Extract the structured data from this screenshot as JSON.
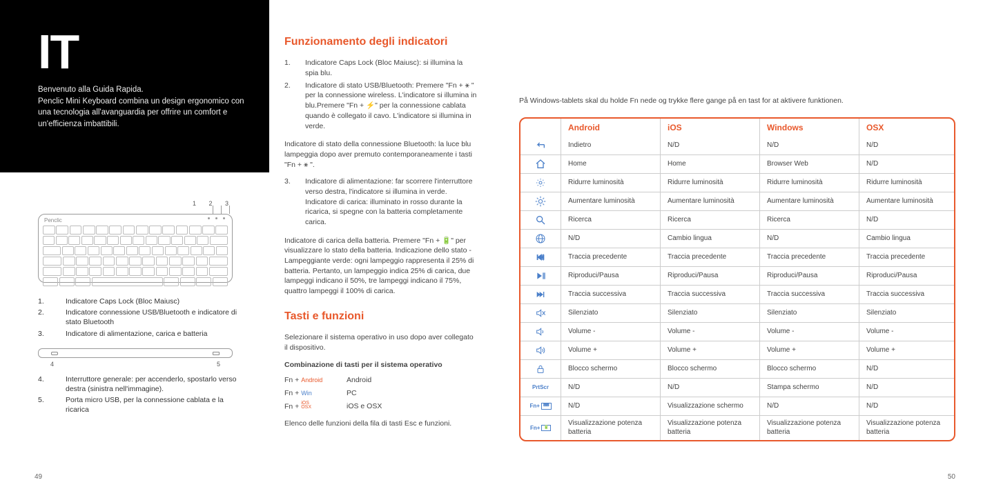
{
  "lang_code": "IT",
  "intro": "Benvenuto alla Guida Rapida.\nPenclic Mini Keyboard combina un design ergonomico con una tecnologia all'avanguardia per offrire un comfort e un'efficienza imbattibili.",
  "kb_top_labels": "1  2  3",
  "kb_brand": "Penclic",
  "indicator_list": [
    {
      "n": "1.",
      "t": "Indicatore Caps Lock (Bloc Maiusc)"
    },
    {
      "n": "2.",
      "t": "Indicatore connessione USB/Bluetooth e indicatore di stato Bluetooth"
    },
    {
      "n": "3.",
      "t": "Indicatore di alimentazione, carica e batteria"
    }
  ],
  "side_labels": {
    "l": "4",
    "r": "5"
  },
  "switch_list": [
    {
      "n": "4.",
      "t": "Interruttore generale: per accenderlo, spostarlo verso destra (sinistra nell'immagine)."
    },
    {
      "n": "5.",
      "t": "Porta micro USB, per la connessione cablata e la ricarica"
    }
  ],
  "section1_heading": "Funzionamento degli indicatori",
  "section1_items": [
    {
      "n": "1.",
      "t": "Indicatore Caps Lock (Bloc Maiusc): si illumina la spia blu."
    },
    {
      "n": "2.",
      "t": "Indicatore di stato USB/Bluetooth: Premere \"Fn + ⚹ \" per la connessione wireless. L'indicatore si illumina in blu.Premere \"Fn + ⚡\" per la connessione cablata quando è collegato il cavo. L'indicatore si illumina in verde."
    }
  ],
  "section1_para1": "Indicatore di stato della connessione Bluetooth: la luce blu lampeggia dopo aver premuto contemporaneamente i tasti \"Fn + ⚹ \".",
  "section1_item3": {
    "n": "3.",
    "t": "Indicatore di alimentazione: far scorrere l'interruttore verso destra, l'indicatore si illumina in verde. Indicatore di carica: illuminato in rosso durante la ricarica, si spegne con la batteria completamente carica."
  },
  "section1_para2": "Indicatore di carica della batteria. Premere \"Fn + 🔋\" per visualizzare lo stato della batteria. Indicazione dello stato - Lampeggiante verde: ogni lampeggio rappresenta il 25% di batteria. Pertanto, un lampeggio indica 25% di carica, due lampeggi indicano il 50%, tre lampeggi indicano il 75%, quattro lampeggi il 100% di carica.",
  "section2_heading": "Tasti e funzioni",
  "section2_para1": "Selezionare il sistema operativo in uso dopo aver collegato il dispositivo.",
  "section2_bold": "Combinazione di tasti per il sistema operativo",
  "combos": [
    {
      "key_pre": "Fn + ",
      "key_accent": "Android",
      "accent_class": "accent",
      "val": "Android"
    },
    {
      "key_pre": "Fn + ",
      "key_accent": "Win",
      "accent_class": "accent2",
      "val": "PC"
    },
    {
      "key_pre": "Fn + ",
      "key_accent": "iOS\nOSX",
      "accent_class": "accent3",
      "val": "iOS e OSX"
    }
  ],
  "section2_para2": "Elenco delle funzioni della fila di tasti Esc e funzioni.",
  "page_left": "49",
  "page_right": "50",
  "top_note": "På Windows-tablets skal du holde Fn nede og trykke flere gange på en tast for at aktivere funktionen.",
  "table": {
    "headers": [
      "",
      "Android",
      "iOS",
      "Windows",
      "OSX"
    ],
    "rows": [
      {
        "icon": "back",
        "cells": [
          "Indietro",
          "N/D",
          "N/D",
          "N/D"
        ]
      },
      {
        "icon": "home",
        "cells": [
          "Home",
          "Home",
          "Browser Web",
          "N/D"
        ]
      },
      {
        "icon": "bright-down",
        "cells": [
          "Ridurre luminosità",
          "Ridurre luminosità",
          "Ridurre luminosità",
          "Ridurre luminosità"
        ]
      },
      {
        "icon": "bright-up",
        "cells": [
          "Aumentare luminosità",
          "Aumentare luminosità",
          "Aumentare luminosità",
          "Aumentare luminosità"
        ]
      },
      {
        "icon": "search",
        "cells": [
          "Ricerca",
          "Ricerca",
          "Ricerca",
          "N/D"
        ]
      },
      {
        "icon": "globe",
        "cells": [
          "N/D",
          "Cambio lingua",
          "N/D",
          "Cambio lingua"
        ]
      },
      {
        "icon": "prev",
        "cells": [
          "Traccia precedente",
          "Traccia precedente",
          "Traccia precedente",
          "Traccia precedente"
        ]
      },
      {
        "icon": "play",
        "cells": [
          "Riproduci/Pausa",
          "Riproduci/Pausa",
          "Riproduci/Pausa",
          "Riproduci/Pausa"
        ]
      },
      {
        "icon": "next",
        "cells": [
          "Traccia successiva",
          "Traccia successiva",
          "Traccia successiva",
          "Traccia successiva"
        ]
      },
      {
        "icon": "mute",
        "cells": [
          "Silenziato",
          "Silenziato",
          "Silenziato",
          "Silenziato"
        ]
      },
      {
        "icon": "vol-down",
        "cells": [
          "Volume -",
          "Volume -",
          "Volume -",
          "Volume -"
        ]
      },
      {
        "icon": "vol-up",
        "cells": [
          "Volume +",
          "Volume +",
          "Volume +",
          "Volume +"
        ]
      },
      {
        "icon": "lock",
        "cells": [
          "Blocco schermo",
          "Blocco schermo",
          "Blocco schermo",
          "N/D"
        ]
      },
      {
        "icon": "prtscr",
        "cells": [
          "N/D",
          "N/D",
          "Stampa schermo",
          "N/D"
        ]
      },
      {
        "icon": "fn-kb",
        "cells": [
          "N/D",
          "Visualizzazione schermo",
          "N/D",
          "N/D"
        ]
      },
      {
        "icon": "fn-batt",
        "cells": [
          "Visualizzazione potenza batteria",
          "Visualizzazione potenza batteria",
          "Visualizzazione potenza batteria",
          "Visualizzazione potenza batteria"
        ]
      }
    ]
  }
}
